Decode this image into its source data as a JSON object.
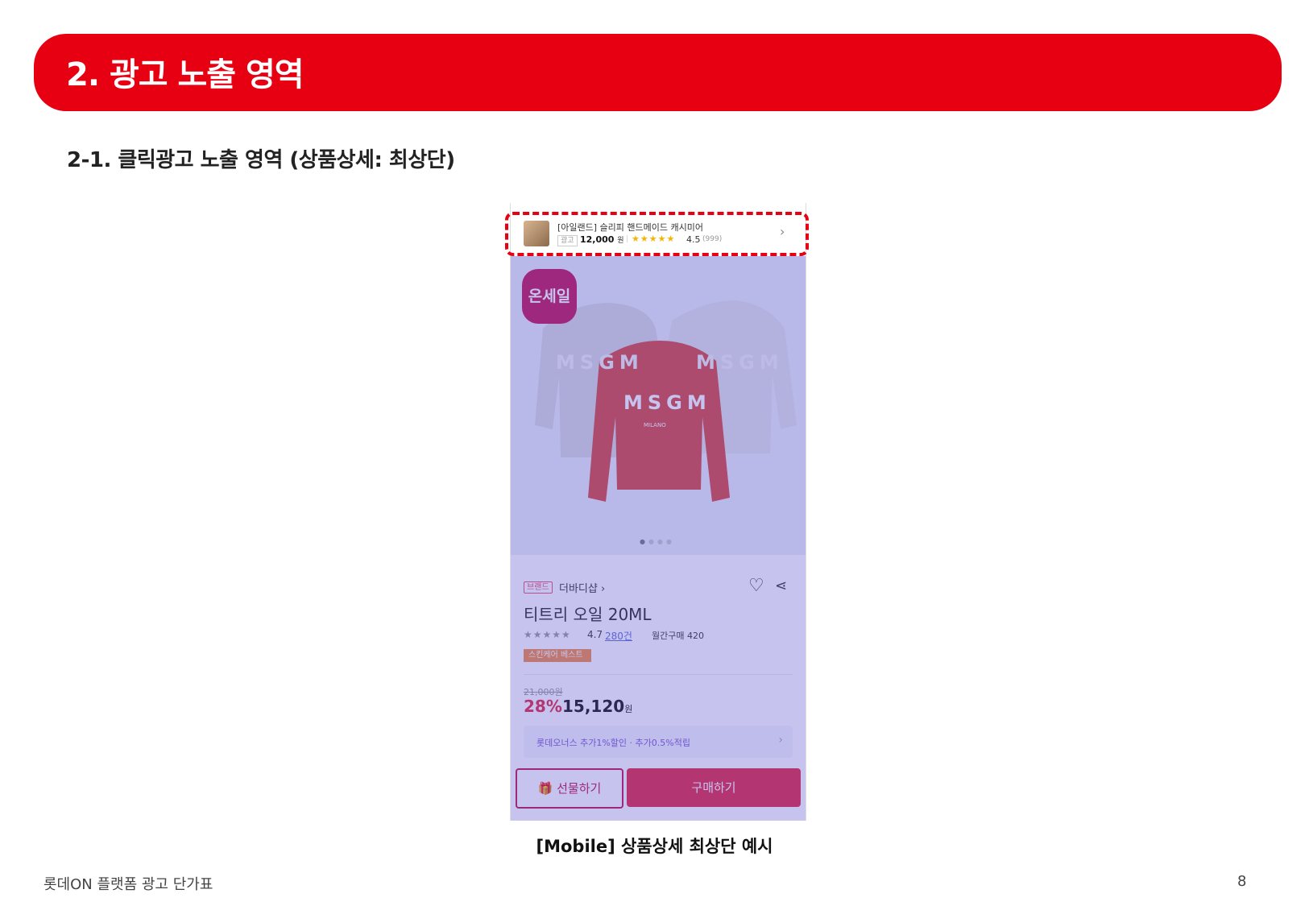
{
  "header": {
    "title": "2. 광고 노출 영역"
  },
  "subtitle": "2-1. 클릭광고 노출 영역 (상품상세: 최상단)",
  "ad_bar": {
    "title": "[아일랜드] 슬리피 핸드메이드 캐시미어",
    "tag": "광고",
    "price": "12,000",
    "price_unit": "원",
    "separator": "|",
    "stars": "★★★★★",
    "rating": "4.5",
    "review_count": "(999)"
  },
  "product": {
    "badge": "온세일",
    "brand_tag": "브랜드",
    "brand_name": "더바디샵 ›",
    "name": "티트리 오일 20ML",
    "stars": "★★★★★",
    "rating": "4.7",
    "reviews": "280건",
    "monthly": "월간구매 420",
    "best_tag": "스킨케어 베스트",
    "original_price": "21,000원",
    "discount": "28%",
    "sale_price": "15,120",
    "price_unit": "원",
    "benefit": "롯데오너스 추가1%할인 · 추가0.5%적립",
    "gift_button": "🎁 선물하기",
    "buy_button": "구매하기",
    "sweater_text": "MSGM",
    "sweater_subtext": "MILANO"
  },
  "caption": "[Mobile] 상품상세 최상단 예시",
  "footer": {
    "left": "롯데ON 플랫폼 광고 단가표",
    "page": "8"
  },
  "colors": {
    "brand_red": "#e60012",
    "overlay": "#5c56cd"
  }
}
